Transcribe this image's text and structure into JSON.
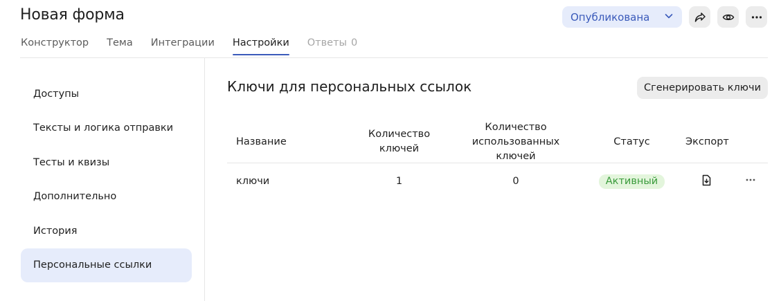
{
  "header": {
    "title": "Новая форма",
    "status_label": "Опубликована"
  },
  "tabs": [
    {
      "label": "Конструктор"
    },
    {
      "label": "Тема"
    },
    {
      "label": "Интеграции"
    },
    {
      "label": "Настройки"
    },
    {
      "label": "Ответы",
      "count": "0"
    }
  ],
  "sidebar": {
    "items": [
      {
        "label": "Доступы"
      },
      {
        "label": "Тексты и логика отправки"
      },
      {
        "label": "Тесты и квизы"
      },
      {
        "label": "Дополнительно"
      },
      {
        "label": "История"
      },
      {
        "label": "Персональные ссылки"
      }
    ]
  },
  "main": {
    "title": "Ключи для персональных ссылок",
    "generate_label": "Сгенерировать ключи",
    "table": {
      "headers": {
        "name": "Название",
        "keys_count_1": "Количество",
        "keys_count_2": "ключей",
        "used_count_1": "Количество",
        "used_count_2": "использованных ключей",
        "status": "Статус",
        "export": "Экспорт"
      },
      "rows": [
        {
          "name": "ключи",
          "keys": "1",
          "used": "0",
          "status": "Активный"
        }
      ]
    }
  },
  "colors": {
    "accent": "#3a5aba",
    "accent_bg": "#e6ecfb",
    "active_badge_bg": "#e3f5dc",
    "active_badge_text": "#3a9b3c"
  },
  "icons": [
    "chevron-down-icon",
    "share-icon",
    "eye-icon",
    "more-icon",
    "export-file-icon",
    "more-horizontal-icon"
  ]
}
